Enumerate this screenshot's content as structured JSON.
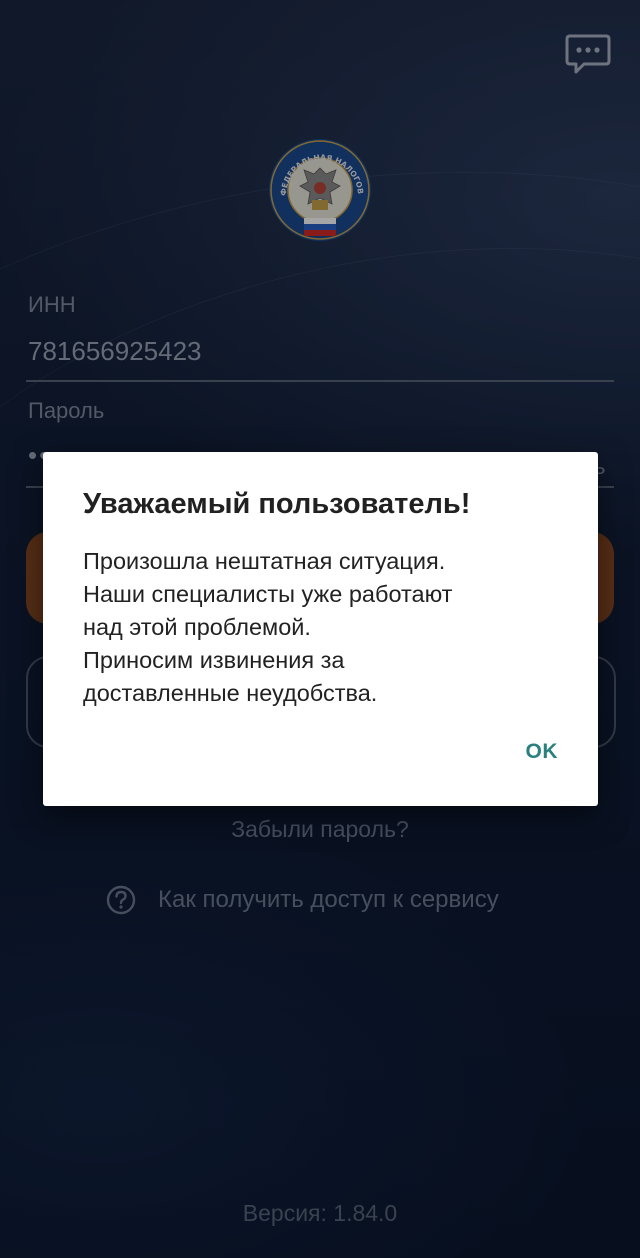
{
  "header": {
    "chat_icon": "chat-bubble-icon",
    "logo": {
      "icon": "fns-emblem-icon",
      "text": "ФЕДЕРАЛЬНАЯ НАЛОГОВАЯ СЛУЖБА"
    }
  },
  "form": {
    "inn_label": "ИНН",
    "inn_value": "781656925423",
    "password_label": "Пароль"
  },
  "links": {
    "forgot_password": "Забыли пароль?",
    "how_to_access": "Как получить доступ к сервису",
    "how_to_icon": "question-circle-icon"
  },
  "footer": {
    "version": "Версия: 1.84.0"
  },
  "dialog": {
    "title": "Уважаемый пользователь!",
    "body_lines": [
      "Произошла нештатная ситуация.",
      "Наши специалисты уже работают",
      "над этой проблемой.",
      "Приносим извинения за",
      "доставленные неудобства."
    ],
    "ok_label": "OK"
  },
  "colors": {
    "background": "#111e38",
    "accent_orange": "#9b4f20",
    "dialog_button": "#2a7f7f",
    "dialog_bg": "#ffffff"
  }
}
